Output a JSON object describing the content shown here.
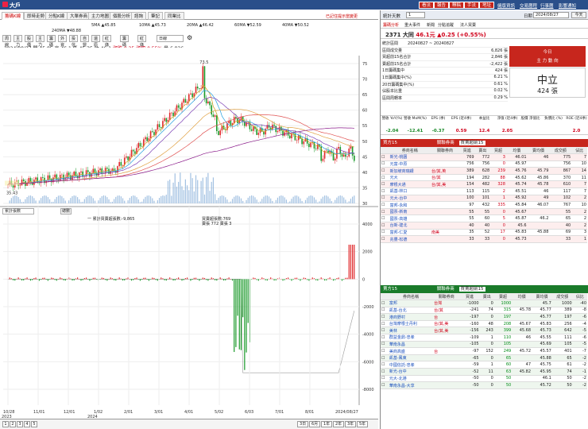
{
  "app": {
    "title": "大戶",
    "top_buttons": [
      "看法",
      "報告",
      "釋稿",
      "手法",
      "地址"
    ],
    "top_links": [
      "儲版資訊",
      "交易曆程",
      "行事曆",
      "影響通知"
    ]
  },
  "tabs": [
    {
      "label": "籌碼K線",
      "active": true
    },
    {
      "label": "即時走勢"
    },
    {
      "label": "分點K線"
    },
    {
      "label": "大單券商"
    },
    {
      "label": "主力地圖"
    },
    {
      "label": "個股分析"
    },
    {
      "label": "諮詢"
    },
    {
      "label": "筆記"
    },
    {
      "label": "同業比"
    }
  ],
  "tab_extra": "已記住提示當變更",
  "ma_legend": [
    {
      "label": "5MA ▲45.85",
      "color": "#d4a017"
    },
    {
      "label": "10MA ▲45.73",
      "color": "#23a0e0"
    },
    {
      "label": "20MA ▲46.42",
      "color": "#7b3fb5"
    },
    {
      "label": "60MA ▼52.59",
      "color": "#e05050"
    },
    {
      "label": "40MA ▼50.52",
      "color": "#e0a040"
    },
    {
      "label": "240MA ▼48.88",
      "color": "#8a1a8a"
    }
  ],
  "toolbar": [
    "周線",
    "主力",
    "股價",
    "主力",
    "籌碼",
    "外資",
    "投信",
    "自營",
    "還原",
    "紅綠轉",
    "籌碼力",
    "紅綠線"
  ],
  "toolbar_select": "日線",
  "info": {
    "date": "2024/08/27",
    "open": "開 45.85",
    "high": "高 46.1",
    "low": "低 45.35",
    "close": "收 46.1",
    "change": "漲跌 0.25",
    "pct": "漲幅 0.55%",
    "volume": "量 6,826"
  },
  "price_axis": [
    "75",
    "70",
    "65",
    "60",
    "55",
    "50",
    "45",
    "40",
    "35",
    "30"
  ],
  "peak_label": "73.5",
  "low_label": "35.43",
  "lower": {
    "select": "累計張數",
    "btn": "總數",
    "legend_a": "一 累計買賣超張數:-9,865",
    "legend_b": "買賣超張數:769",
    "legend_c": "賣張 772 賣張 3"
  },
  "lower_axis": [
    "4000",
    "2000",
    "0",
    "-2000",
    "-4000",
    "-6000",
    "-8000"
  ],
  "x_axis": [
    "10/28",
    "11/01",
    "12/01",
    "1/02",
    "2/01",
    "3/01",
    "4/01",
    "5/02",
    "6/03",
    "7/01",
    "8/01",
    "2024/08/27"
  ],
  "x_years": [
    "2023",
    "2024"
  ],
  "bottom": {
    "pages": [
      "1",
      "2",
      "3",
      "4",
      "5"
    ],
    "periods": [
      "3日",
      "6月",
      "1年",
      "2年",
      "3年",
      "5年"
    ]
  },
  "stats": {
    "header": "統計天數",
    "days": "1",
    "date_label": "日期",
    "date": "2024/08/27",
    "today_btn": "今天",
    "subtabs": [
      "籌碼分析",
      "重大事件",
      "新聞",
      "分點追蹤",
      "法人買賣"
    ],
    "stock": "2371 大同",
    "price": "46.1元",
    "change": "▲0.25 (+0.55%)",
    "range_label": "統計區間",
    "range": "20240827 ~ 20240827",
    "rows": [
      {
        "k": "區間成交量",
        "v": "6,826 張"
      },
      {
        "k": "買超前15名合計",
        "v": "2,846 張"
      },
      {
        "k": "賣超前15名合計",
        "v": "-2,422 張"
      },
      {
        "k": "1日籌碼集中",
        "v": "424 張"
      },
      {
        "k": "1日籌碼集中(%)",
        "v": "6.21 %"
      },
      {
        "k": "20日籌碼集中(%)",
        "v": "0.61 %"
      },
      {
        "k": "佔股本比重",
        "v": "0.02 %"
      },
      {
        "k": "區間周轉率",
        "v": "0.29 %"
      }
    ],
    "today_title": "今日",
    "today_sub": "主 力 動 向",
    "today_status": "中立",
    "today_qty": "424 張",
    "ratio_heads": [
      "營收 YoY(%)",
      "營收 MoM(%)",
      "EPS (季)",
      "EPS (近4季)",
      "本益比",
      "淨值 (近4季)",
      "股價 淨值比",
      "負債比 (%)",
      "ROE (近4季)"
    ],
    "ratio_vals": [
      "-2.04",
      "-12.41",
      "-0.37",
      "0.59",
      "12.4",
      "2.05",
      "",
      "",
      "2.0"
    ]
  },
  "buy_panel": {
    "title": "買方15",
    "sort": "關聯券商",
    "sel": "買賣超前15",
    "heads": [
      "",
      "券商名稱",
      "關聯券商",
      "買進",
      "賣出",
      "買超",
      "均價",
      "賣均價",
      "成交額",
      "佔比"
    ],
    "rows": [
      [
        "新光-桃園",
        "",
        "769",
        "772",
        "3",
        "46.01",
        "46",
        "775",
        "7"
      ],
      [
        "元富-中原",
        "",
        "756",
        "756",
        "0",
        "45.97",
        "",
        "756",
        "10"
      ],
      [
        "新加坡商瑞銀",
        "台/其,英",
        "389",
        "628",
        "239",
        "45.76",
        "45.79",
        "867",
        "14"
      ],
      [
        "元大",
        "台/其",
        "194",
        "282",
        "88",
        "45.62",
        "45.86",
        "370",
        "11"
      ],
      [
        "摩根大通",
        "台/其,美",
        "154",
        "482",
        "328",
        "45.74",
        "45.78",
        "610",
        "7"
      ],
      [
        "凱基-林口",
        "",
        "113",
        "115",
        "2",
        "45.51",
        "46",
        "117",
        "7"
      ],
      [
        "元大-台中",
        "",
        "100",
        "101",
        "1",
        "45.92",
        "49",
        "102",
        "2"
      ],
      [
        "富邦-永和",
        "",
        "97",
        "432",
        "335",
        "45.84",
        "46.07",
        "767",
        "10"
      ],
      [
        "國票-新南",
        "",
        "55",
        "55",
        "0",
        "45.67",
        "",
        "55",
        "2"
      ],
      [
        "國票-高雄",
        "",
        "55",
        "60",
        "5",
        "45.87",
        "46.2",
        "65",
        "2"
      ],
      [
        "台新-建北",
        "",
        "40",
        "40",
        "0",
        "45.6",
        "",
        "40",
        "2"
      ],
      [
        "富邦-仁愛",
        "南美",
        "35",
        "52",
        "17",
        "45.83",
        "45.88",
        "69",
        "3"
      ],
      [
        "兆豐-松德",
        "",
        "33",
        "33",
        "0",
        "45.73",
        "",
        "33",
        "1"
      ]
    ]
  },
  "sell_panel": {
    "title": "賣方15",
    "sort": "關聯券商",
    "sel": "買賣超前15",
    "heads": [
      "",
      "券商名稱",
      "關聯券商",
      "買進",
      "賣出",
      "賣超",
      "均價",
      "賣均價",
      "成交額",
      "佔比"
    ],
    "rows": [
      [
        "富邦",
        "台灣",
        "-1000",
        "0",
        "1000",
        "",
        "45.7",
        "1000",
        "-40"
      ],
      [
        "凱基-台北",
        "台/其",
        "-241",
        "74",
        "315",
        "45.78",
        "45.77",
        "389",
        "-8"
      ],
      [
        "港商野村",
        "台",
        "-197",
        "0",
        "197",
        "",
        "45.77",
        "197",
        "-6"
      ],
      [
        "台灣摩根士丹利",
        "台/其,美",
        "-160",
        "48",
        "208",
        "45.67",
        "45.83",
        "256",
        "-4"
      ],
      [
        "美林",
        "台/其,美",
        "-156",
        "243",
        "399",
        "45.68",
        "45.73",
        "642",
        "-5"
      ],
      [
        "群益金鼎-忠孝",
        "",
        "-109",
        "1",
        "110",
        "46",
        "45.55",
        "111",
        "-6"
      ],
      [
        "華南永昌",
        "",
        "-105",
        "0",
        "105",
        "",
        "45.69",
        "105",
        "-5"
      ],
      [
        "美商高盛",
        "台",
        "-97",
        "152",
        "249",
        "45.72",
        "45.57",
        "401",
        "-7"
      ],
      [
        "凱基-鳳東",
        "",
        "-65",
        "0",
        "65",
        "",
        "45.88",
        "65",
        "-2"
      ],
      [
        "中國信託-忠孝",
        "",
        "-59",
        "1",
        "60",
        "47",
        "45.75",
        "61",
        "-2"
      ],
      [
        "新光-台中",
        "",
        "-52",
        "11",
        "63",
        "45.82",
        "45.95",
        "74",
        "-1"
      ],
      [
        "元大-北港",
        "",
        "-50",
        "0",
        "50",
        "",
        "46.1",
        "50",
        "-2"
      ],
      [
        "華南永昌-大享",
        "",
        "-50",
        "0",
        "50",
        "",
        "45.72",
        "50",
        "-2"
      ]
    ]
  }
}
